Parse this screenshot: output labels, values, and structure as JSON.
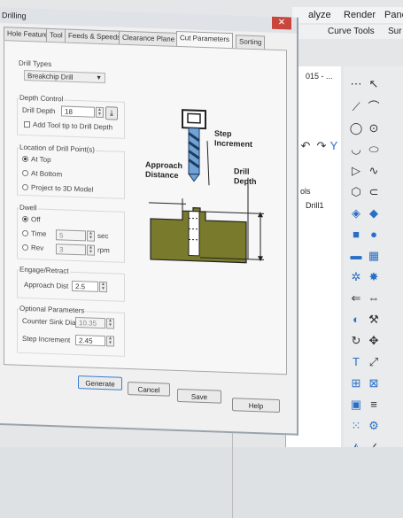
{
  "background_app": {
    "menu": [
      "alyze",
      "Render",
      "Pane"
    ],
    "toolbar": [
      "Curve Tools",
      "Sur"
    ],
    "panel_header": "015 - ...",
    "panel_items": [
      "ols",
      "Drill1"
    ]
  },
  "dialog": {
    "title": "Drilling",
    "close": "✕",
    "tabs": [
      "Hole Features",
      "Tool",
      "Feeds & Speeds",
      "Clearance Plane",
      "Cut Parameters",
      "Sorting"
    ],
    "active_tab": "Cut Parameters",
    "drill_types": {
      "label": "Drill Types",
      "value": "Breakchip Drill"
    },
    "depth_control": {
      "label": "Depth Control",
      "drill_depth_label": "Drill Depth",
      "drill_depth_value": "18",
      "add_tool_tip_label": "Add Tool tip to Drill Depth"
    },
    "location": {
      "label": "Location of Drill Point(s)",
      "options": [
        "At Top",
        "At Bottom",
        "Project to 3D Model"
      ],
      "selected": "At Top"
    },
    "dwell": {
      "label": "Dwell",
      "options": [
        "Off",
        "Time",
        "Rev"
      ],
      "selected": "Off",
      "time_value": "5",
      "time_unit": "sec",
      "rev_value": "3",
      "rev_unit": "rpm"
    },
    "engage": {
      "label": "Engage/Retract",
      "approach_label": "Approach Dist",
      "approach_value": "2.5"
    },
    "optional": {
      "label": "Optional Parameters",
      "counter_sink_label": "Counter Sink Dia",
      "counter_sink_value": "10.35",
      "step_increment_label": "Step Increment",
      "step_increment_value": "2.45"
    },
    "diagram_labels": {
      "step_increment": [
        "Step",
        "Increment"
      ],
      "approach_distance": [
        "Approach",
        "Distance"
      ],
      "drill_depth": [
        "Drill",
        "Depth"
      ]
    },
    "buttons": {
      "generate": "Generate",
      "cancel": "Cancel",
      "save": "Save",
      "help": "Help"
    }
  },
  "colors": {
    "stock": "#7a7a2c",
    "tool": "#6fa3d8",
    "accent": "#3d7bd3"
  }
}
